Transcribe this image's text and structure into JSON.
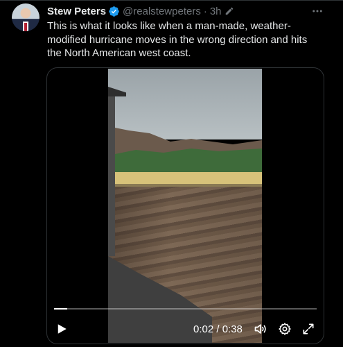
{
  "tweet": {
    "author_name": "Stew Peters",
    "handle": "@realstewpeters",
    "separator": "·",
    "time": "3h",
    "verified": true,
    "text": "This is what it looks like when a man-made, weather-modified hurricane moves in the wrong direction and hits the North American west coast."
  },
  "video": {
    "current_time": "0:02",
    "duration": "0:38",
    "time_display": "0:02 / 0:38",
    "progress": 0.05
  },
  "icons": {
    "verified": "verified-badge-icon",
    "edited": "edit-pencil-icon",
    "more": "more-options-icon",
    "play": "play-icon",
    "volume": "volume-icon",
    "settings": "gear-icon",
    "fullscreen": "fullscreen-icon"
  },
  "colors": {
    "background": "#000000",
    "text_primary": "#e7e9ea",
    "text_secondary": "#71767b",
    "verified_blue": "#1d9bf0",
    "border": "#2f3336"
  }
}
